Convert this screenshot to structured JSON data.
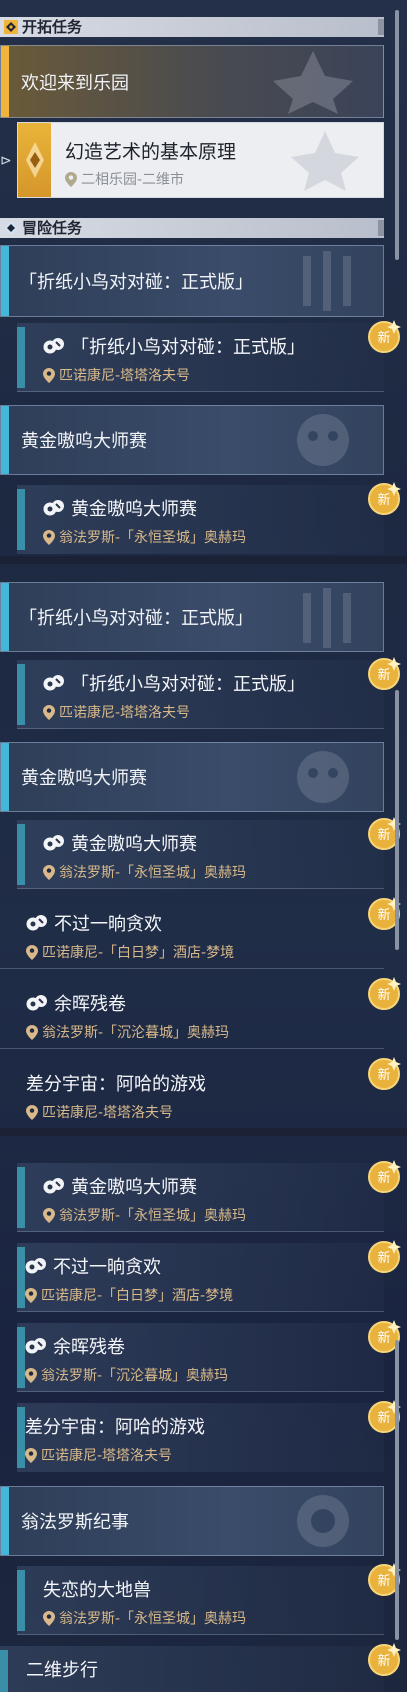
{
  "sections": {
    "trailblaze": "开拓任务",
    "adventure": "冒险任务"
  },
  "badge_new": "新",
  "trailblaze_category": "欢迎来到乐园",
  "selected_quest": {
    "title": "幻造艺术的基本原理",
    "location": "二相乐园-二维市"
  },
  "panel1": {
    "cat_paper_bird": "「折纸小鸟对对碰：正式版」",
    "q_paper_bird": {
      "title": "「折纸小鸟对对碰：正式版」",
      "location": "匹诺康尼-塔塔洛夫号"
    },
    "cat_golden": "黄金嗷呜大师赛",
    "q_golden": {
      "title": "黄金嗷呜大师赛",
      "location": "翁法罗斯-「永恒圣城」奥赫玛"
    }
  },
  "panel2": {
    "cat_paper_bird": "「折纸小鸟对对碰：正式版」",
    "q_paper_bird": {
      "title": "「折纸小鸟对对碰：正式版」",
      "location": "匹诺康尼-塔塔洛夫号"
    },
    "cat_golden": "黄金嗷呜大师赛",
    "q_golden": {
      "title": "黄金嗷呜大师赛",
      "location": "翁法罗斯-「永恒圣城」奥赫玛"
    },
    "q_daydream": {
      "title": "不过一晌贪欢",
      "location": "匹诺康尼-「白日梦」酒店-梦境"
    },
    "q_afterglow": {
      "title": "余晖残卷",
      "location": "翁法罗斯-「沉沦暮城」奥赫玛"
    },
    "q_diff": {
      "title": "差分宇宙：阿哈的游戏",
      "location": "匹诺康尼-塔塔洛夫号"
    }
  },
  "panel3": {
    "q_golden": {
      "title": "黄金嗷呜大师赛",
      "location": "翁法罗斯-「永恒圣城」奥赫玛"
    },
    "q_daydream": {
      "title": "不过一晌贪欢",
      "location": "匹诺康尼-「白日梦」酒店-梦境"
    },
    "q_afterglow": {
      "title": "余晖残卷",
      "location": "翁法罗斯-「沉沦暮城」奥赫玛"
    },
    "q_diff": {
      "title": "差分宇宙：阿哈的游戏",
      "location": "匹诺康尼-塔塔洛夫号"
    },
    "cat_chronicle": "翁法罗斯纪事",
    "q_lovelorn": {
      "title": "失恋的大地兽",
      "location": "翁法罗斯-「永恒圣城」奥赫玛"
    },
    "q_2d_walk": {
      "title": "二维步行"
    }
  },
  "colors": {
    "accent_blue": "#43b7d9",
    "gold": "#f0b43a",
    "location": "#d9b98a"
  },
  "icons": [
    "diamond-icon",
    "location-pin-icon",
    "quest-type-icon",
    "new-badge-icon",
    "select-arrow-icon"
  ]
}
